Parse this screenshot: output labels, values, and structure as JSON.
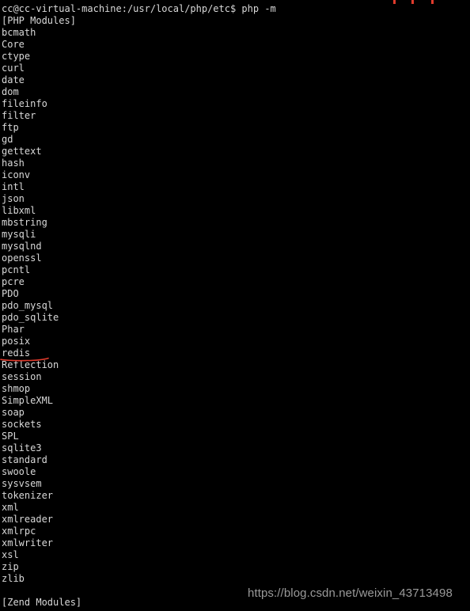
{
  "terminal": {
    "prompt_line": "cc@cc-virtual-machine:/usr/local/php/etc$ php -m",
    "header": "[PHP Modules]",
    "footer": "[Zend Modules]",
    "blank": "",
    "foreground_color": "#d8d8d8",
    "background_color": "#000000",
    "cut_row_ghost_text": "",
    "modules": [
      "bcmath",
      "Core",
      "ctype",
      "curl",
      "date",
      "dom",
      "fileinfo",
      "filter",
      "ftp",
      "gd",
      "gettext",
      "hash",
      "iconv",
      "intl",
      "json",
      "libxml",
      "mbstring",
      "mysqli",
      "mysqlnd",
      "openssl",
      "pcntl",
      "pcre",
      "PDO",
      "pdo_mysql",
      "pdo_sqlite",
      "Phar",
      "posix",
      "redis",
      "Reflection",
      "session",
      "shmop",
      "SimpleXML",
      "soap",
      "sockets",
      "SPL",
      "sqlite3",
      "standard",
      "swoole",
      "sysvsem",
      "tokenizer",
      "xml",
      "xmlreader",
      "xmlrpc",
      "xmlwriter",
      "xsl",
      "zip",
      "zlib"
    ]
  },
  "annotation": {
    "target_module": "redis",
    "color": "#e03b2c",
    "shape": "hand-drawn-underline"
  },
  "watermark": {
    "text": "https://blog.csdn.net/weixin_43713498",
    "color": "#9a9a9a"
  }
}
